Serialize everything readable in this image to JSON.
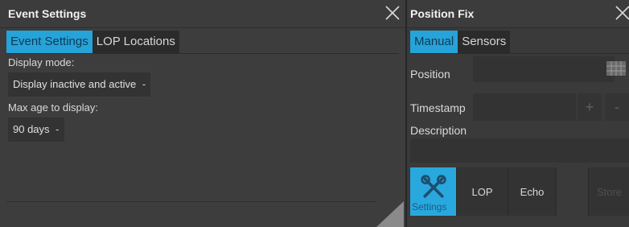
{
  "event_settings": {
    "title": "Event Settings",
    "tabs": [
      {
        "label": "Event Settings",
        "active": true
      },
      {
        "label": "LOP Locations",
        "active": false
      }
    ],
    "display_mode": {
      "label": "Display mode:",
      "value": "Display inactive and active",
      "caret": "-"
    },
    "max_age": {
      "label": "Max age to display:",
      "value": "90 days",
      "caret": "-"
    },
    "close_icon": "close-icon"
  },
  "position_fix": {
    "title": "Position Fix",
    "tabs": [
      {
        "label": "Manual",
        "active": true
      },
      {
        "label": "Sensors",
        "active": false
      }
    ],
    "position_label": "Position",
    "timestamp_label": "Timestamp",
    "timestamp_plus": "+",
    "timestamp_minus": "-",
    "description_label": "Description",
    "buttons": [
      {
        "label": "Settings",
        "icon": "tools-icon",
        "active": true
      },
      {
        "label": "LOP",
        "active": false
      },
      {
        "label": "Echo",
        "active": false
      },
      {
        "label": "",
        "active": false
      },
      {
        "label": "Store",
        "active": false,
        "disabled": true
      }
    ]
  },
  "colors": {
    "accent": "#26a3d9",
    "panel_bg": "#3d3d3d",
    "field_bg": "#333333",
    "text": "#e6e6e6"
  }
}
